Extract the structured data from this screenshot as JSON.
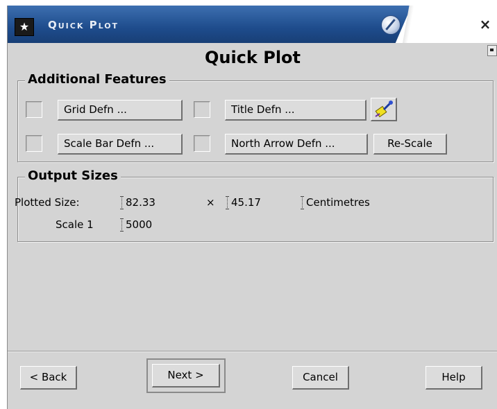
{
  "window": {
    "title": "Quick Plot",
    "app_icon": "star-icon",
    "shade_icon": "shade-icon",
    "close_icon": "close-icon",
    "close_glyph": "×"
  },
  "heading": "Quick Plot",
  "additional_features": {
    "title": "Additional Features",
    "grid_button": "Grid Defn ...",
    "title_button": "Title Defn ...",
    "scale_bar_button": "Scale Bar Defn ...",
    "north_arrow_button": "North Arrow Defn ...",
    "rescale_button": "Re-Scale",
    "wand_icon": "magic-wand-icon"
  },
  "output_sizes": {
    "title": "Output Sizes",
    "plotted_size_label": "Plotted Size:",
    "width_value": "82.33",
    "times_sign": "×",
    "height_value": "45.17",
    "units": "Centimetres",
    "scale_label": "Scale 1",
    "scale_value": "5000"
  },
  "footer": {
    "back": "< Back",
    "next": "Next >",
    "cancel": "Cancel",
    "help": "Help"
  },
  "colors": {
    "titlebar": "#1e4c8c",
    "window_bg": "#d4d4d4"
  }
}
